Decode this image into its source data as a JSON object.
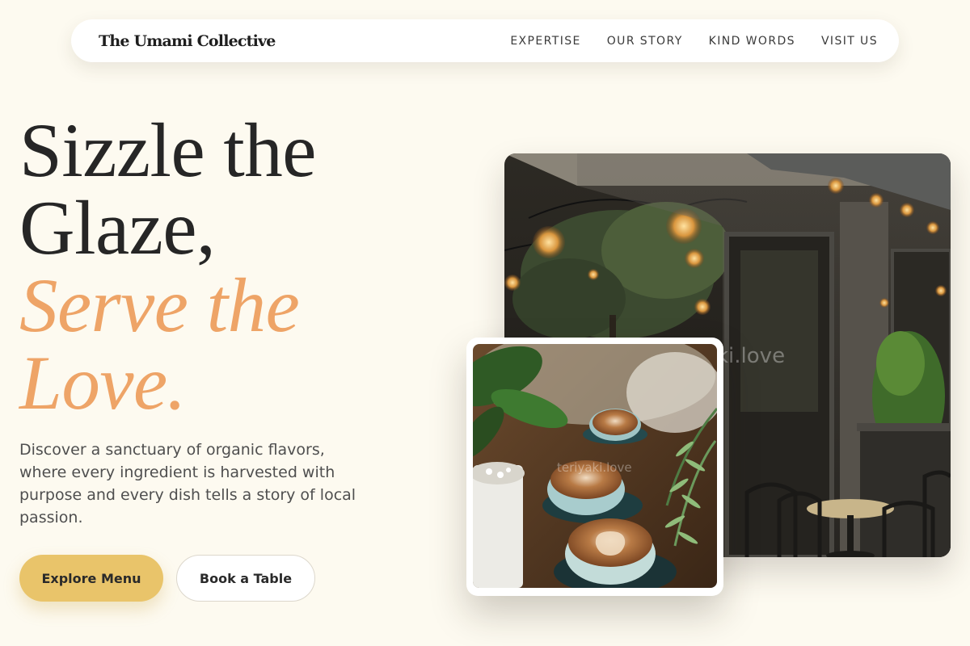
{
  "nav": {
    "brand": "The Umami Collective",
    "links": [
      "EXPERTISE",
      "OUR STORY",
      "KIND WORDS",
      "VISIT US"
    ]
  },
  "hero": {
    "headline_line1": "Sizzle the",
    "headline_line2": "Glaze,",
    "headline_line3": "Serve the",
    "headline_line4": "Love.",
    "lead": "Discover a sanctuary of organic flavors, where every ingredient is harvested with purpose and every dish tells a story of local passion.",
    "primary_button": "Explore Menu",
    "secondary_button": "Book a Table"
  },
  "images": {
    "main_watermark": "ki.love",
    "small_watermark": "teriyaki.love"
  },
  "colors": {
    "background": "#fdfaf0",
    "accent": "#eea467",
    "primary_button": "#e9c46a"
  }
}
